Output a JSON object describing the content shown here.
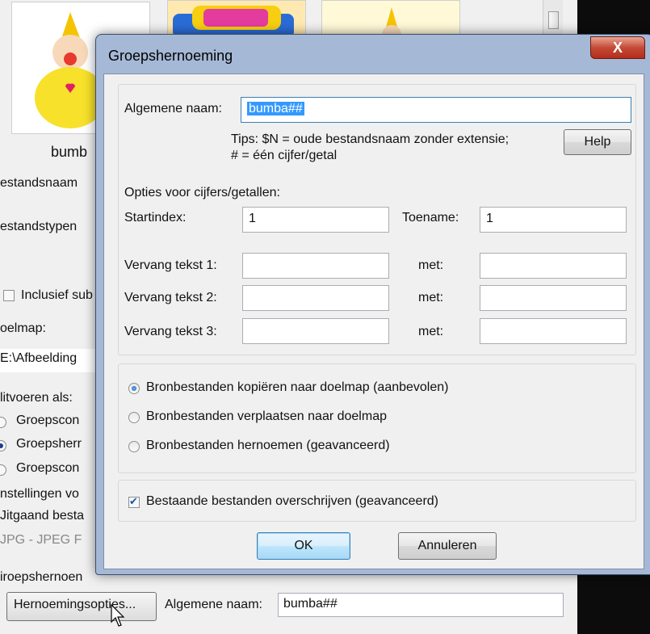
{
  "background": {
    "thumb_caption": "bumb",
    "labels": {
      "bestandsnaam": "estandsnaam",
      "bestandstypen": "estandstypen",
      "inclusief": "Inclusief sub",
      "doelmap": "oelmap:",
      "path": "E:\\Afbeelding",
      "uitvoeren": "litvoeren als:",
      "groeps1": "Groepscon",
      "groeps2": "Groepsherr",
      "groeps3": "Groepscon",
      "instellingen": "nstellingen vo",
      "uitgaand": "Jitgaand besta",
      "jpg": "JPG - JPEG F",
      "groepshernoem": "iroepshernoen"
    },
    "bottom": {
      "options_button": "Hernoemingsopties...",
      "algemene_label": "Algemene naam:",
      "algemene_value": "bumba##"
    }
  },
  "dialog": {
    "title": "Groepshernoeming",
    "close_label": "X",
    "name_label": "Algemene naam:",
    "name_value": "bumba##",
    "tips_line1": "Tips: $N = oude bestandsnaam zonder extensie;",
    "tips_line2": "# = één cijfer/getal",
    "help_label": "Help",
    "options_heading": "Opties voor cijfers/getallen:",
    "startindex_label": "Startindex:",
    "startindex_value": "1",
    "toename_label": "Toename:",
    "toename_value": "1",
    "replace_rows": [
      {
        "label": "Vervang tekst 1:",
        "met": "met:",
        "value": "",
        "with": ""
      },
      {
        "label": "Vervang tekst 2:",
        "met": "met:",
        "value": "",
        "with": ""
      },
      {
        "label": "Vervang tekst 3:",
        "met": "met:",
        "value": "",
        "with": ""
      }
    ],
    "radio_options": [
      {
        "label": "Bronbestanden kopiëren naar doelmap (aanbevolen)",
        "selected": true
      },
      {
        "label": "Bronbestanden verplaatsen naar doelmap",
        "selected": false
      },
      {
        "label": "Bronbestanden hernoemen (geavanceerd)",
        "selected": false
      }
    ],
    "overwrite_label": "Bestaande bestanden overschrijven (geavanceerd)",
    "overwrite_checked": true,
    "ok_label": "OK",
    "cancel_label": "Annuleren"
  },
  "colors": {
    "dialog_frame": "#a5b9d6",
    "close_button": "#c54a36",
    "selection": "#3399ff"
  }
}
